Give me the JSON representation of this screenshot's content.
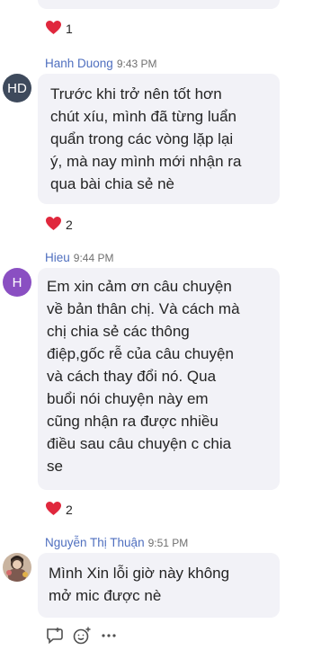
{
  "messages": [
    {
      "reaction_count": "1"
    },
    {
      "sender": "Hanh Duong",
      "time": "9:43 PM",
      "avatar_initials": "HD",
      "avatar_color": "#3e4a5c",
      "text": "Trước khi trở nên tốt hơn\nchút xíu, mình đã từng luẩn\nquẩn trong các vòng lặp lại\ný, mà nay mình mới nhận ra\nqua bài chia sẻ nè",
      "reaction_count": "2"
    },
    {
      "sender": "Hieu",
      "time": "9:44 PM",
      "avatar_initials": "H",
      "avatar_color": "#8a4fc2",
      "text": "Em xin cảm ơn câu chuyện\nvề bản thân chị. Và cách mà\nchị chia sẻ các thông\nđiệp,gốc rễ của câu chuyện\nvà cách thay đổi nó. Qua\nbuổi nói chuyện này em\ncũng nhận ra được nhiều\nđiều sau câu chuyện c chia\nse",
      "reaction_count": "2"
    },
    {
      "sender": "Nguyễn Thị Thuận",
      "time": "9:51 PM",
      "text": "Mình Xin lỗi giờ này không\nmở mic được nè"
    }
  ],
  "icons": {
    "heart": "heart-icon",
    "reply": "reply-icon",
    "emoji": "emoji-add-icon",
    "more": "more-options-icon"
  },
  "colors": {
    "heart": "#e0283d",
    "sender_name": "#4f6fbf",
    "bubble": "#f2f2f7"
  }
}
